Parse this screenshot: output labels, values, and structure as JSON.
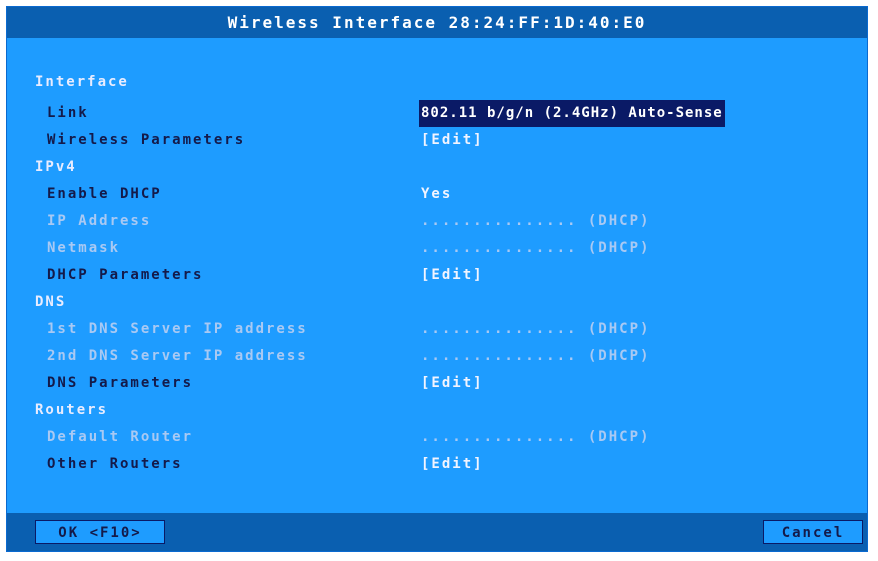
{
  "dialog": {
    "title": "Wireless Interface 28:24:FF:1D:40:E0"
  },
  "rows": {
    "interface": {
      "label": "Interface"
    },
    "link": {
      "label": "Link",
      "value": "802.11 b/g/n (2.4GHz) Auto-Sense"
    },
    "wireless_params": {
      "label": "Wireless Parameters",
      "value": "[Edit]"
    },
    "ipv4": {
      "label": "IPv4"
    },
    "enable_dhcp": {
      "label": "Enable DHCP",
      "value": "Yes"
    },
    "ip_address": {
      "label": "IP Address",
      "value": "............... (DHCP)"
    },
    "netmask": {
      "label": "Netmask",
      "value": "............... (DHCP)"
    },
    "dhcp_params": {
      "label": "DHCP Parameters",
      "value": "[Edit]"
    },
    "dns": {
      "label": "DNS"
    },
    "dns1": {
      "label": "1st DNS Server IP address",
      "value": "............... (DHCP)"
    },
    "dns2": {
      "label": "2nd DNS Server IP address",
      "value": "............... (DHCP)"
    },
    "dns_params": {
      "label": "DNS Parameters",
      "value": "[Edit]"
    },
    "routers": {
      "label": "Routers"
    },
    "default_router": {
      "label": "Default Router",
      "value": "............... (DHCP)"
    },
    "other_routers": {
      "label": "Other Routers",
      "value": "[Edit]"
    }
  },
  "buttons": {
    "ok": "OK <F10>",
    "cancel": "Cancel"
  },
  "colors": {
    "dialog_bg": "#1e9cff",
    "titlebar_bg": "#0a5fb0",
    "highlight_bg": "#0a1a66",
    "text_dark": "#141a4a",
    "text_disabled": "#a9c9f3",
    "text_light": "#f2f4ff"
  }
}
